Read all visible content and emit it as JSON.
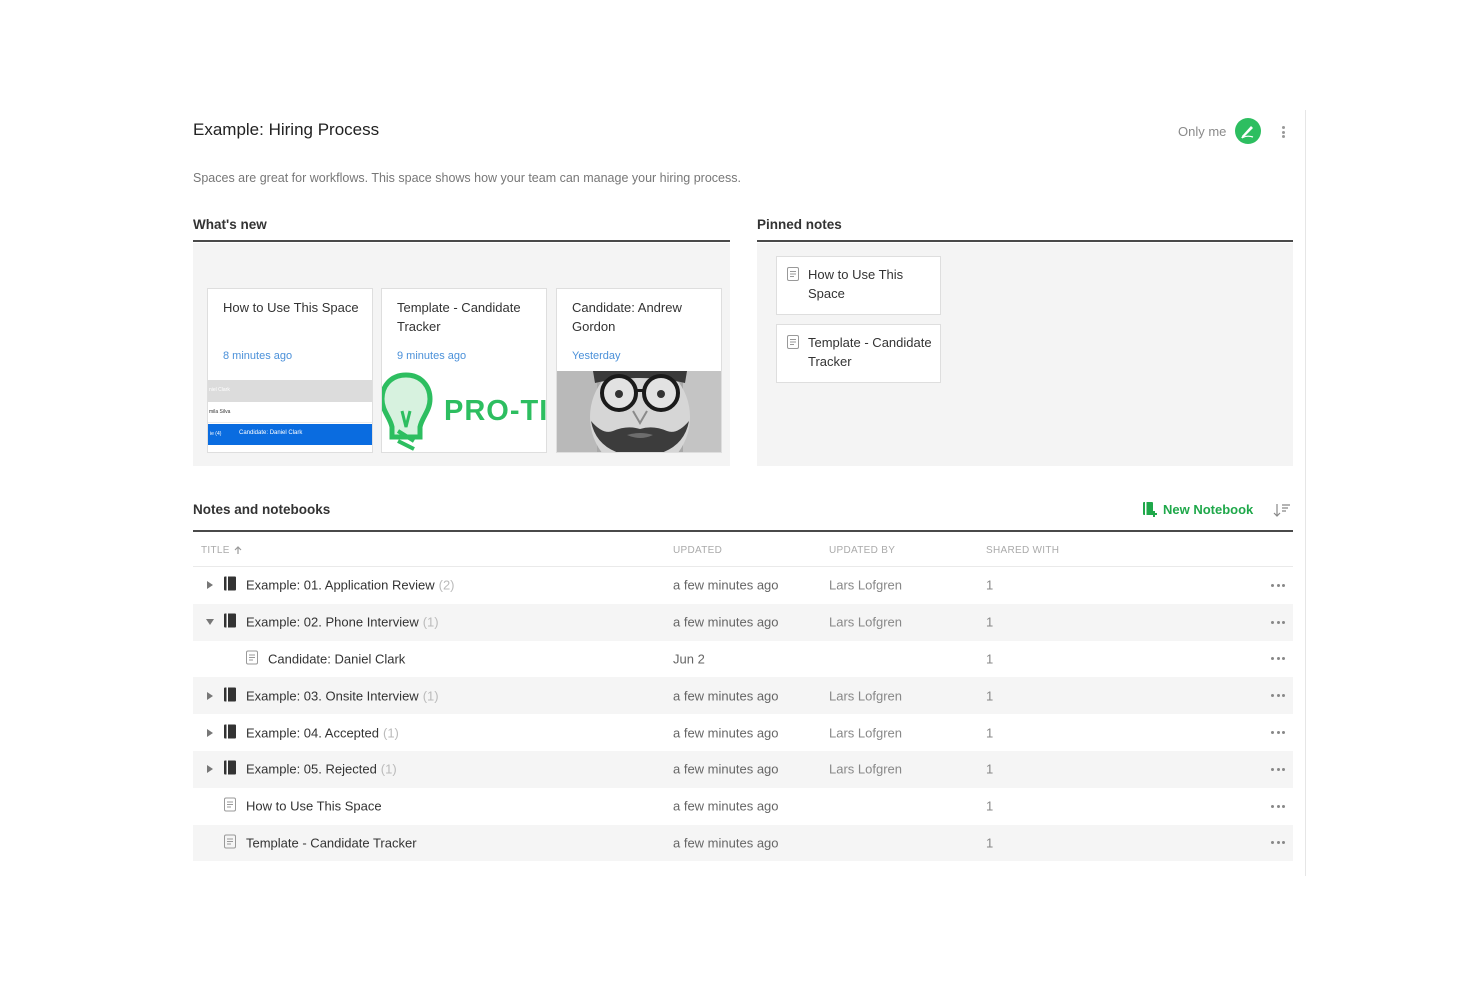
{
  "header": {
    "title": "Example: Hiring Process",
    "share_label": "Only me",
    "description": "Spaces are great for workflows. This space shows how your team can manage your hiring process."
  },
  "whats_new": {
    "heading": "What's new",
    "cards": [
      {
        "title": "How to Use This Space",
        "time": "8 minutes ago",
        "thumb": "table-screenshot"
      },
      {
        "title": "Template - Candidate Tracker",
        "time": "9 minutes ago",
        "thumb": "pro-tip-logo"
      },
      {
        "title": "Candidate: Andrew Gordon",
        "time": "Yesterday",
        "thumb": "portrait-photo"
      }
    ],
    "thumb_table": {
      "row1": "niel Clark",
      "row2": "mila Silva",
      "row3_prefix": "ie (4)",
      "row3": "Candidate: Daniel Clark"
    },
    "thumb_pro": "PRO-TI"
  },
  "pinned": {
    "heading": "Pinned notes",
    "items": [
      {
        "title": "How to Use This Space"
      },
      {
        "title": "Template - Candidate Tracker"
      }
    ]
  },
  "notes": {
    "heading": "Notes and notebooks",
    "new_notebook_label": "New Notebook",
    "columns": {
      "title": "TITLE",
      "updated": "UPDATED",
      "updated_by": "UPDATED BY",
      "shared_with": "SHARED WITH"
    },
    "rows": [
      {
        "type": "notebook",
        "expand": "collapsed",
        "title": "Example: 01. Application Review",
        "count": "(2)",
        "updated": "a few minutes ago",
        "by": "Lars Lofgren",
        "shared": "1"
      },
      {
        "type": "notebook",
        "expand": "expanded",
        "title": "Example: 02. Phone Interview",
        "count": "(1)",
        "updated": "a few minutes ago",
        "by": "Lars Lofgren",
        "shared": "1"
      },
      {
        "type": "note-child",
        "expand": "none",
        "title": "Candidate: Daniel Clark",
        "count": "",
        "updated": "Jun 2",
        "by": "",
        "shared": "1"
      },
      {
        "type": "notebook",
        "expand": "collapsed",
        "title": "Example: 03. Onsite Interview",
        "count": "(1)",
        "updated": "a few minutes ago",
        "by": "Lars Lofgren",
        "shared": "1"
      },
      {
        "type": "notebook",
        "expand": "collapsed",
        "title": "Example: 04. Accepted",
        "count": "(1)",
        "updated": "a few minutes ago",
        "by": "Lars Lofgren",
        "shared": "1"
      },
      {
        "type": "notebook",
        "expand": "collapsed",
        "title": "Example: 05. Rejected",
        "count": "(1)",
        "updated": "a few minutes ago",
        "by": "Lars Lofgren",
        "shared": "1"
      },
      {
        "type": "note",
        "expand": "none",
        "title": "How to Use This Space",
        "count": "",
        "updated": "a few minutes ago",
        "by": "",
        "shared": "1"
      },
      {
        "type": "note",
        "expand": "none",
        "title": "Template - Candidate Tracker",
        "count": "",
        "updated": "a few minutes ago",
        "by": "",
        "shared": "1"
      }
    ]
  },
  "colors": {
    "accent": "#2dbe60",
    "link": "#4a90d9",
    "selection": "#0a6ce0"
  }
}
